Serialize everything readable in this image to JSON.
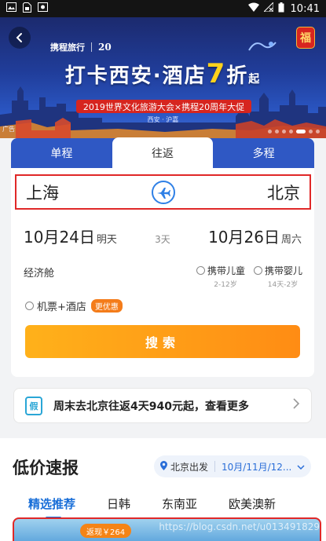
{
  "status_bar": {
    "time": "10:41"
  },
  "banner": {
    "logo_text": "携程旅行",
    "anniversary": "20",
    "title_prefix": "打卡西安·酒店",
    "title_highlight": "7",
    "title_mid": "折",
    "title_suffix": "起",
    "subtitle": "2019世界文化旅游大会×携程20周年大促",
    "city_line": "西安 · 沪嘉",
    "ad_label": "广告",
    "badge": "福",
    "slides_total": 7,
    "slide_active": 5
  },
  "trip_tabs": [
    "单程",
    "往返",
    "多程"
  ],
  "route": {
    "from": "上海",
    "to": "北京"
  },
  "dates": {
    "depart": "10月24日",
    "depart_week": "明天",
    "nights": "3天",
    "return": "10月26日",
    "return_week": "周六"
  },
  "cabin": "经济舱",
  "passengers": {
    "child": "携带儿童",
    "child_age": "2-12岁",
    "infant": "携带婴儿",
    "infant_age": "14天-2岁"
  },
  "combo": {
    "label": "机票+酒店",
    "badge": "更优惠"
  },
  "search_button": "搜索",
  "promo": {
    "icon_text": "假",
    "text": "周末去北京往返4天940元起，查看更多"
  },
  "deals": {
    "title": "低价速报",
    "depart_city": "北京出发",
    "depart_date": "10月/11月/12...",
    "tabs": [
      "精选推荐",
      "日韩",
      "东南亚",
      "欧美澳新"
    ],
    "price_badge": "返现￥264",
    "watermark": "https://blog.csdn.net/u013491829"
  }
}
